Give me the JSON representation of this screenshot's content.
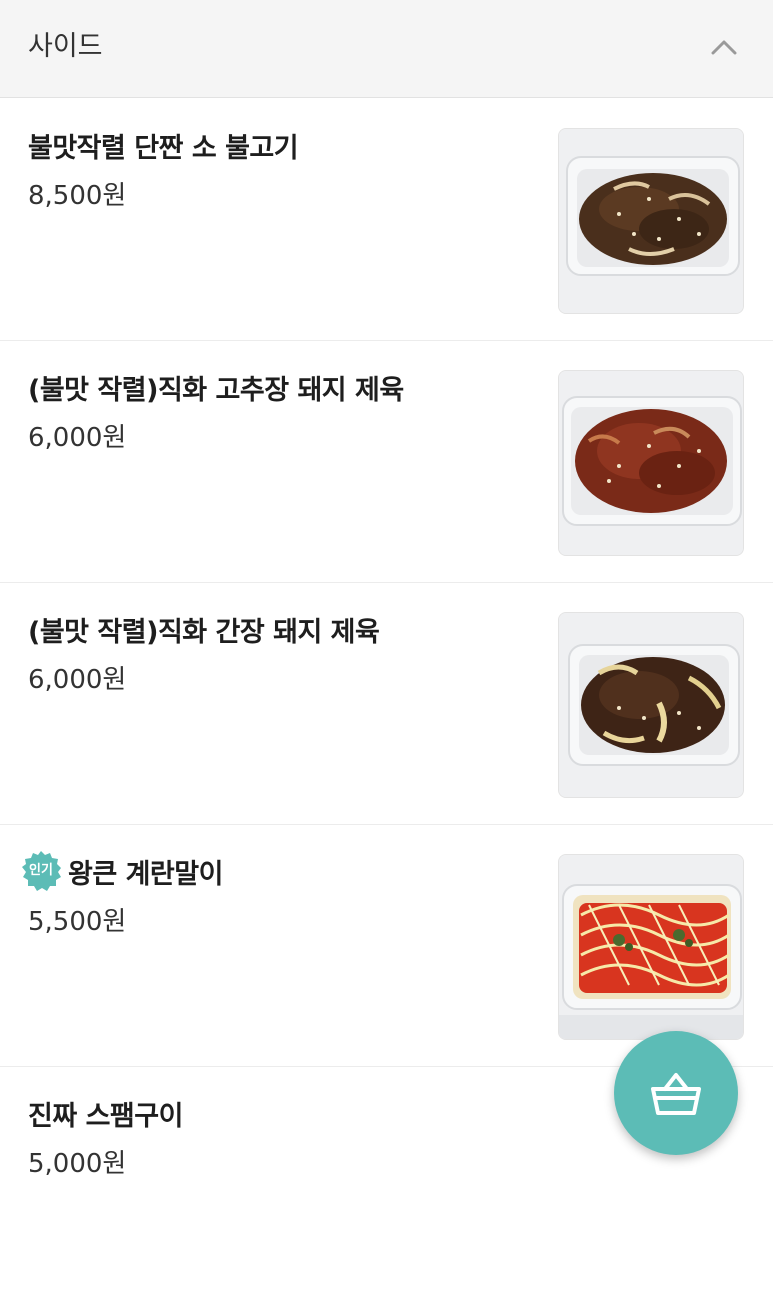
{
  "section": {
    "title": "사이드",
    "collapse_icon": "chevron-up-icon"
  },
  "menu": {
    "items": [
      {
        "name": "불맛작렬 단짠 소 불고기",
        "price": "8,500원",
        "badge": null
      },
      {
        "name": "(불맛 작렬)직화 고추장 돼지 제육",
        "price": "6,000원",
        "badge": null
      },
      {
        "name": "(불맛 작렬)직화 간장 돼지 제육",
        "price": "6,000원",
        "badge": null
      },
      {
        "name": "왕큰 계란말이",
        "price": "5,500원",
        "badge": "인기"
      },
      {
        "name": "진짜 스팸구이",
        "price": "5,000원",
        "badge": null
      }
    ]
  },
  "cart": {
    "icon": "shopping-basket-icon"
  },
  "colors": {
    "accent": "#5cbcb6",
    "header_bg": "#f5f5f5"
  }
}
